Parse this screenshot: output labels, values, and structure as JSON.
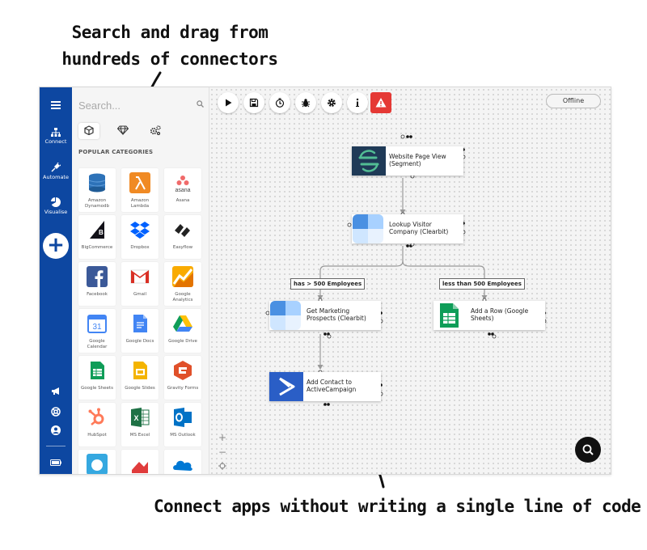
{
  "annotations": {
    "top_line1": "Search and drag from",
    "top_line2": "hundreds of connectors",
    "bottom": "Connect apps without writing a single line of code"
  },
  "rail": {
    "items": [
      {
        "label": "Connect",
        "icon": "sitemap-icon"
      },
      {
        "label": "Automate",
        "icon": "plug-icon"
      },
      {
        "label": "Visualise",
        "icon": "pie-chart-icon"
      }
    ],
    "add_label": "+"
  },
  "panel": {
    "search_placeholder": "Search...",
    "tabs": [
      "cube-icon",
      "diamond-icon",
      "cogs-icon"
    ],
    "category_title": "POPULAR CATEGORIES",
    "connectors": [
      {
        "name": "Amazon Dynamodb",
        "color": "#2d72b8"
      },
      {
        "name": "Amazon Lambda",
        "color": "#f08a24"
      },
      {
        "name": "Asana",
        "color": "#f06a6a"
      },
      {
        "name": "BigCommerce",
        "color": "#121118"
      },
      {
        "name": "Dropbox",
        "color": "#0061ff"
      },
      {
        "name": "Easyflow",
        "color": "#222222"
      },
      {
        "name": "Facebook",
        "color": "#3b5998"
      },
      {
        "name": "Gmail",
        "color": "#d93025"
      },
      {
        "name": "Google Analytics",
        "color": "#f9ab00"
      },
      {
        "name": "Google Calendar",
        "color": "#4285f4"
      },
      {
        "name": "Google Docs",
        "color": "#4285f4"
      },
      {
        "name": "Google Drive",
        "color": "#0f9d58"
      },
      {
        "name": "Google Sheets",
        "color": "#0f9d58"
      },
      {
        "name": "Google Slides",
        "color": "#f4b400"
      },
      {
        "name": "Gravity Forms",
        "color": "#e0502a"
      },
      {
        "name": "HubSpot",
        "color": "#ff7a59"
      },
      {
        "name": "MS Excel",
        "color": "#1e7145"
      },
      {
        "name": "MS Outlook",
        "color": "#0072c6"
      },
      {
        "name": "",
        "color": "#35a8e0"
      },
      {
        "name": "",
        "color": "#e03c3c"
      },
      {
        "name": "",
        "color": "#0078d4"
      }
    ]
  },
  "toolbar": {
    "buttons": [
      "play-icon",
      "save-icon",
      "timer-icon",
      "bug-icon",
      "gear-icon",
      "info-icon"
    ],
    "alert": "warning-icon",
    "status": "Offline"
  },
  "flow": {
    "nodes": [
      {
        "id": "segment",
        "title": "Website Page View (Segment)"
      },
      {
        "id": "clearbit1",
        "title": "Lookup Visitor Company (Clearbit)"
      },
      {
        "id": "clearbit2",
        "title": "Get Marketing Prospects (Clearbit)"
      },
      {
        "id": "sheets",
        "title": "Add a Row (Google Sheets)"
      },
      {
        "id": "activecampaign",
        "title": "Add Contact to ActiveCampaign"
      }
    ],
    "branches": [
      "has > 500 Employees",
      "less than 500 Employees"
    ]
  },
  "zoom": {
    "plus": "+",
    "minus": "−"
  }
}
